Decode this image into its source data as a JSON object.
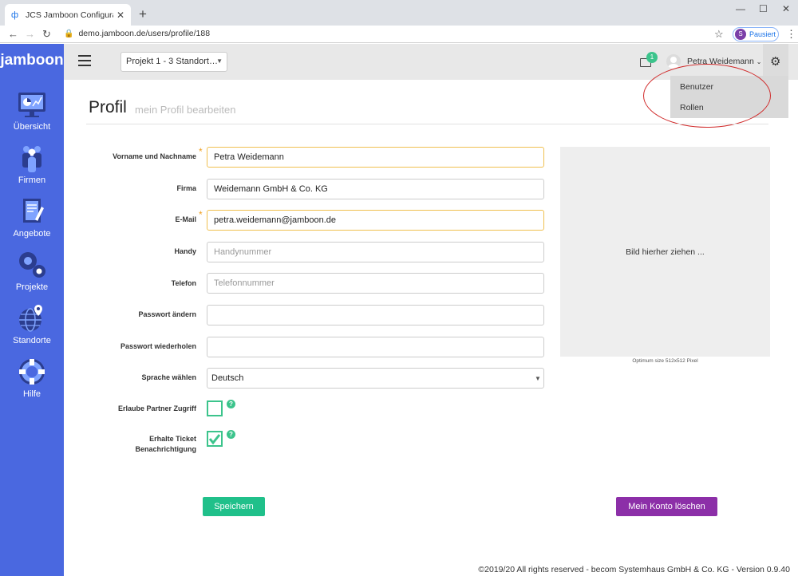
{
  "browser": {
    "tab_title": "JCS Jamboon Configuration Serv",
    "url": "demo.jamboon.de/users/profile/188",
    "profile_initial": "S",
    "profile_status": "Pausiert"
  },
  "app": {
    "logo": "jamboon",
    "accent": "#4a68e0",
    "sidebar": {
      "items": [
        {
          "label": "Übersicht",
          "icon": "dashboard-icon"
        },
        {
          "label": "Firmen",
          "icon": "people-icon"
        },
        {
          "label": "Angebote",
          "icon": "document-icon"
        },
        {
          "label": "Projekte",
          "icon": "gears-icon"
        },
        {
          "label": "Standorte",
          "icon": "globe-pin-icon"
        },
        {
          "label": "Hilfe",
          "icon": "lifebuoy-icon"
        }
      ]
    },
    "topbar": {
      "project": "Projekt 1 - 3 Standort…",
      "mail_badge": "1",
      "user_name": "Petra Weidemann"
    },
    "settings_menu": [
      "Benutzer",
      "Rollen"
    ]
  },
  "page": {
    "title": "Profil",
    "subtitle": "mein Profil bearbeiten"
  },
  "form": {
    "name_label": "Vorname und Nachname",
    "name_value": "Petra Weidemann",
    "company_label": "Firma",
    "company_value": "Weidemann GmbH & Co. KG",
    "email_label": "E-Mail",
    "email_value": "petra.weidemann@jamboon.de",
    "mobile_label": "Handy",
    "mobile_placeholder": "Handynummer",
    "phone_label": "Telefon",
    "phone_placeholder": "Telefonnummer",
    "password_label": "Passwort ändern",
    "password_repeat_label": "Passwort wiederholen",
    "language_label": "Sprache wählen",
    "language_value": "Deutsch",
    "partner_access_label": "Erlaube Partner Zugriff",
    "partner_access_checked": false,
    "ticket_label_1": "Erhalte Ticket",
    "ticket_label_2": "Benachrichtigung",
    "ticket_checked": true,
    "help_glyph": "?",
    "dropzone_text": "Bild hierher ziehen ...",
    "dropzone_hint": "Optimum size 512x512 Pixel",
    "save_label": "Speichern",
    "delete_label": "Mein Konto löschen"
  },
  "footer": "©2019/20 All rights reserved - becom Systemhaus GmbH & Co. KG - Version 0.9.40"
}
